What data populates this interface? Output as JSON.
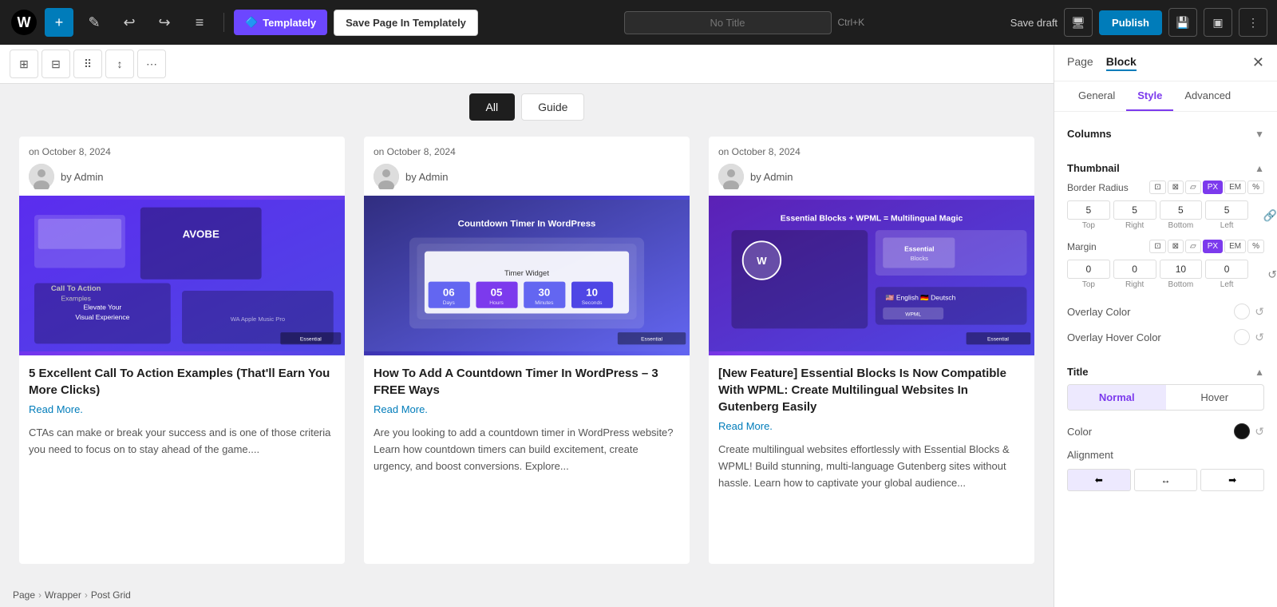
{
  "topbar": {
    "add_label": "+",
    "pencil_icon": "✎",
    "undo_icon": "↩",
    "redo_icon": "↪",
    "menu_icon": "≡",
    "templately_label": "Templately",
    "save_templately_label": "Save Page In Templately",
    "title_placeholder": "No Title",
    "shortcut": "Ctrl+K",
    "save_draft_label": "Save draft",
    "publish_label": "Publish"
  },
  "toolbar": {
    "icon1": "⊞",
    "icon2": "⊟",
    "icon3": "⠿",
    "icon4": "↕",
    "icon5": "⋯"
  },
  "filter": {
    "all_label": "All",
    "guide_label": "Guide"
  },
  "posts": [
    {
      "date": "on October 8, 2024",
      "author": "by Admin",
      "title": "5 Excellent Call To Action Examples (That'll Earn You More Clicks)",
      "read_more": "Read More.",
      "excerpt": "CTAs can make or break your success and is one of those criteria you need to focus on to stay ahead of the game...."
    },
    {
      "date": "on October 8, 2024",
      "author": "by Admin",
      "title": "How To Add A Countdown Timer In WordPress – 3 FREE Ways",
      "read_more": "Read More.",
      "excerpt": "Are you looking to add a countdown timer in WordPress website? Learn how countdown timers can build excitement, create urgency, and boost conversions. Explore..."
    },
    {
      "date": "on October 8, 2024",
      "author": "by Admin",
      "title": "[New Feature] Essential Blocks Is Now Compatible With WPML: Create Multilingual Websites In Gutenberg Easily",
      "read_more": "Read More.",
      "excerpt": "Create multilingual websites effortlessly with Essential Blocks & WPML! Build stunning, multi-language Gutenberg sites without hassle. Learn how to captivate your global audience..."
    }
  ],
  "breadcrumb": {
    "page": "Page",
    "wrapper": "Wrapper",
    "post_grid": "Post Grid"
  },
  "panel": {
    "page_tab": "Page",
    "block_tab": "Block",
    "general_tab": "General",
    "style_tab": "Style",
    "advanced_tab": "Advanced",
    "columns_label": "Columns",
    "thumbnail_label": "Thumbnail",
    "border_radius_label": "Border Radius",
    "border_units": [
      "PX",
      "EM",
      "%"
    ],
    "border_active_unit": "PX",
    "border_values": {
      "top": "5",
      "right": "5",
      "bottom": "5",
      "left": "5"
    },
    "margin_label": "Margin",
    "margin_units": [
      "PX",
      "EM",
      "%"
    ],
    "margin_active_unit": "PX",
    "margin_values": {
      "top": "0",
      "right": "0",
      "bottom": "10",
      "left": "0"
    },
    "overlay_color_label": "Overlay Color",
    "overlay_hover_color_label": "Overlay Hover Color",
    "title_label": "Title",
    "normal_label": "Normal",
    "hover_label": "Hover",
    "color_label": "Color",
    "alignment_label": "Alignment"
  }
}
